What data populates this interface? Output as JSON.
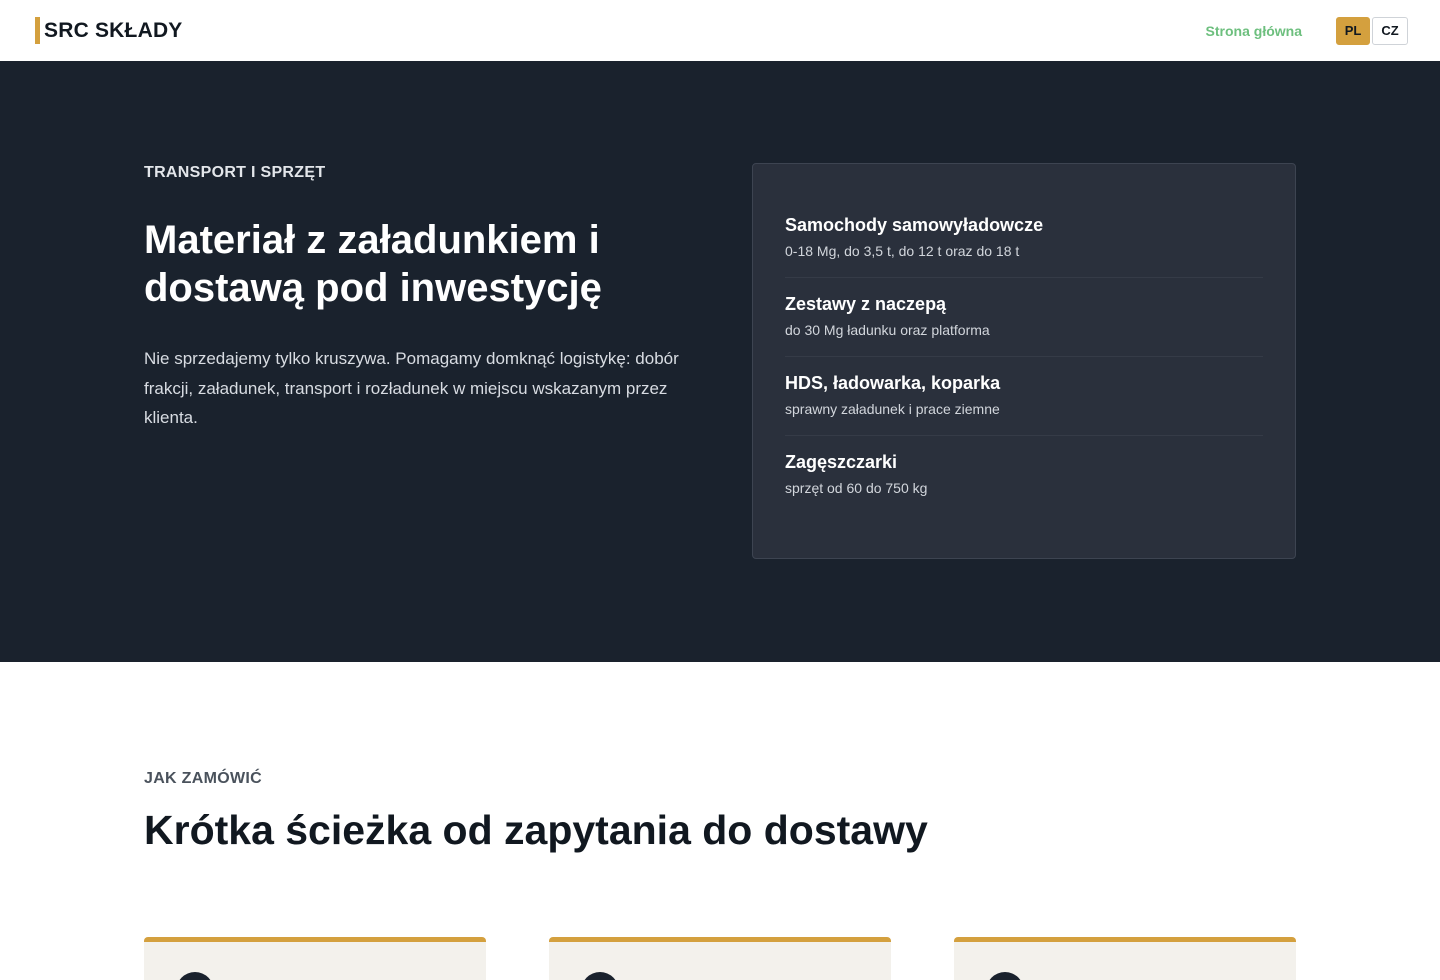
{
  "header": {
    "logo_text": "SRC SKŁADY",
    "nav_home": "Strona główna",
    "lang_pl": "PL",
    "lang_cz": "CZ"
  },
  "hero": {
    "eyebrow": "TRANSPORT I SPRZĘT",
    "title": "Materiał z załadunkiem i dostawą pod inwestycję",
    "text": "Nie sprzedajemy tylko kruszywa. Pomagamy domknąć logistykę: dobór frakcji, załadunek, transport i rozładunek w miejscu wskazanym przez klienta.",
    "equipment": [
      {
        "title": "Samochody samowyładowcze",
        "sub": "0-18 Mg, do 3,5 t, do 12 t oraz do 18 t"
      },
      {
        "title": "Zestawy z naczepą",
        "sub": "do 30 Mg ładunku oraz platforma"
      },
      {
        "title": "HDS, ładowarka, koparka",
        "sub": "sprawny załadunek i prace ziemne"
      },
      {
        "title": "Zagęszczarki",
        "sub": "sprzęt od 60 do 750 kg"
      }
    ]
  },
  "order": {
    "eyebrow": "JAK ZAMÓWIĆ",
    "title": "Krótka ścieżka od zapytania do dostawy"
  },
  "colors": {
    "accent": "#d4a03e",
    "hero_bg": "#1a222d",
    "card_bg": "#2a303c",
    "nav_link": "#6dbf7e"
  }
}
